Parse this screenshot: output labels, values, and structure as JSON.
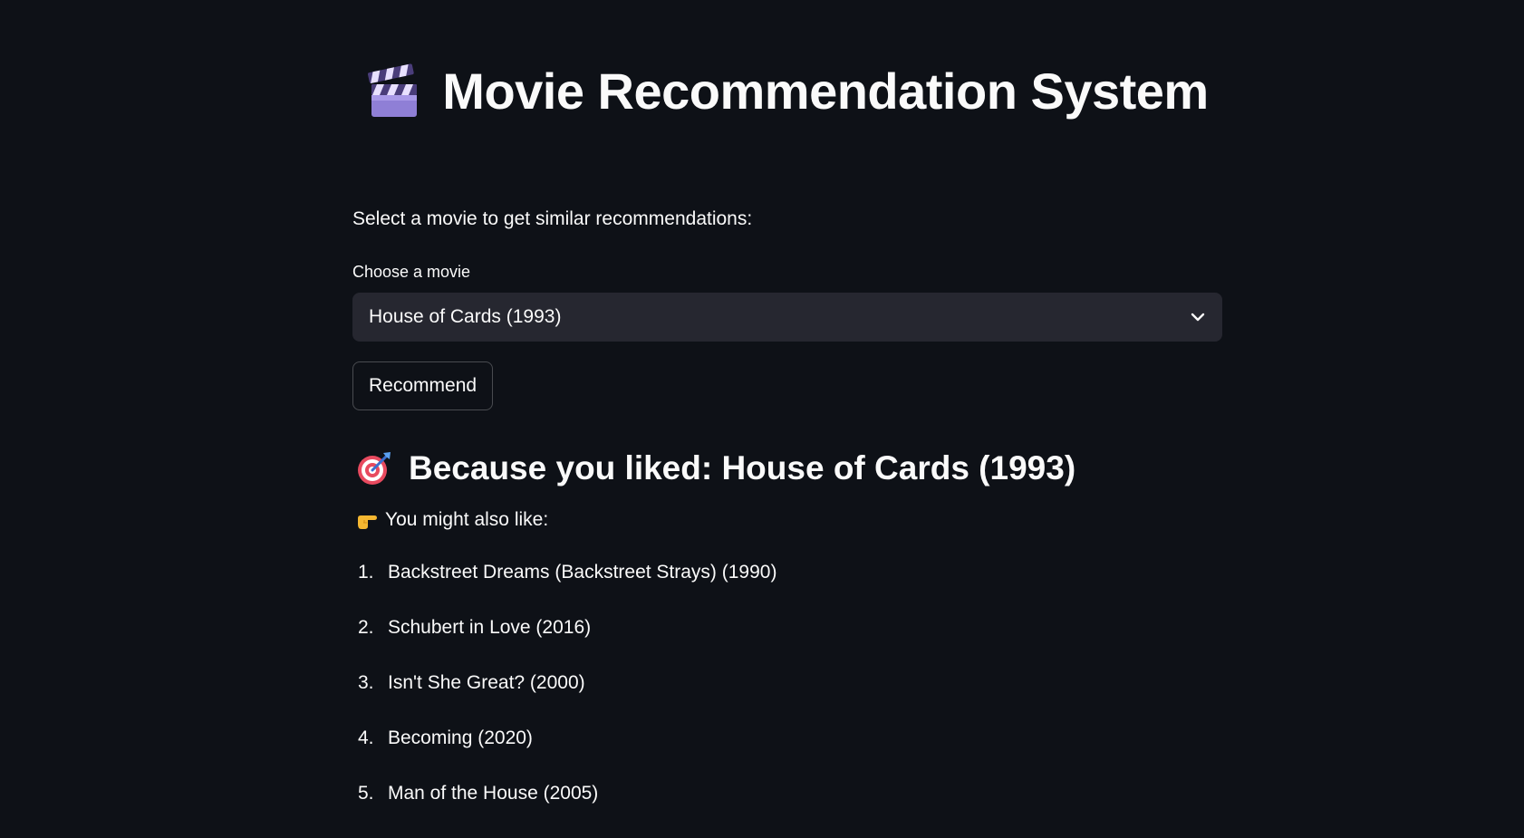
{
  "header": {
    "title": "Movie Recommendation System",
    "icon": "clapper-board-icon"
  },
  "intro_text": "Select a movie to get similar recommendations:",
  "select": {
    "label": "Choose a movie",
    "value": "House of Cards (1993)",
    "icon": "chevron-down-icon"
  },
  "button": {
    "label": "Recommend"
  },
  "results": {
    "heading": "Because you liked: House of Cards (1993)",
    "heading_icon": "target-icon",
    "subheading": "You might also like:",
    "subheading_icon": "pointing-hand-icon",
    "items": [
      {
        "num": "1.",
        "title": "Backstreet Dreams (Backstreet Strays) (1990)"
      },
      {
        "num": "2.",
        "title": "Schubert in Love (2016)"
      },
      {
        "num": "3.",
        "title": "Isn't She Great? (2000)"
      },
      {
        "num": "4.",
        "title": "Becoming (2020)"
      },
      {
        "num": "5.",
        "title": "Man of the House (2005)"
      }
    ]
  },
  "colors": {
    "background": "#0e1117",
    "text": "#fafafa",
    "input_bg": "#262730"
  }
}
